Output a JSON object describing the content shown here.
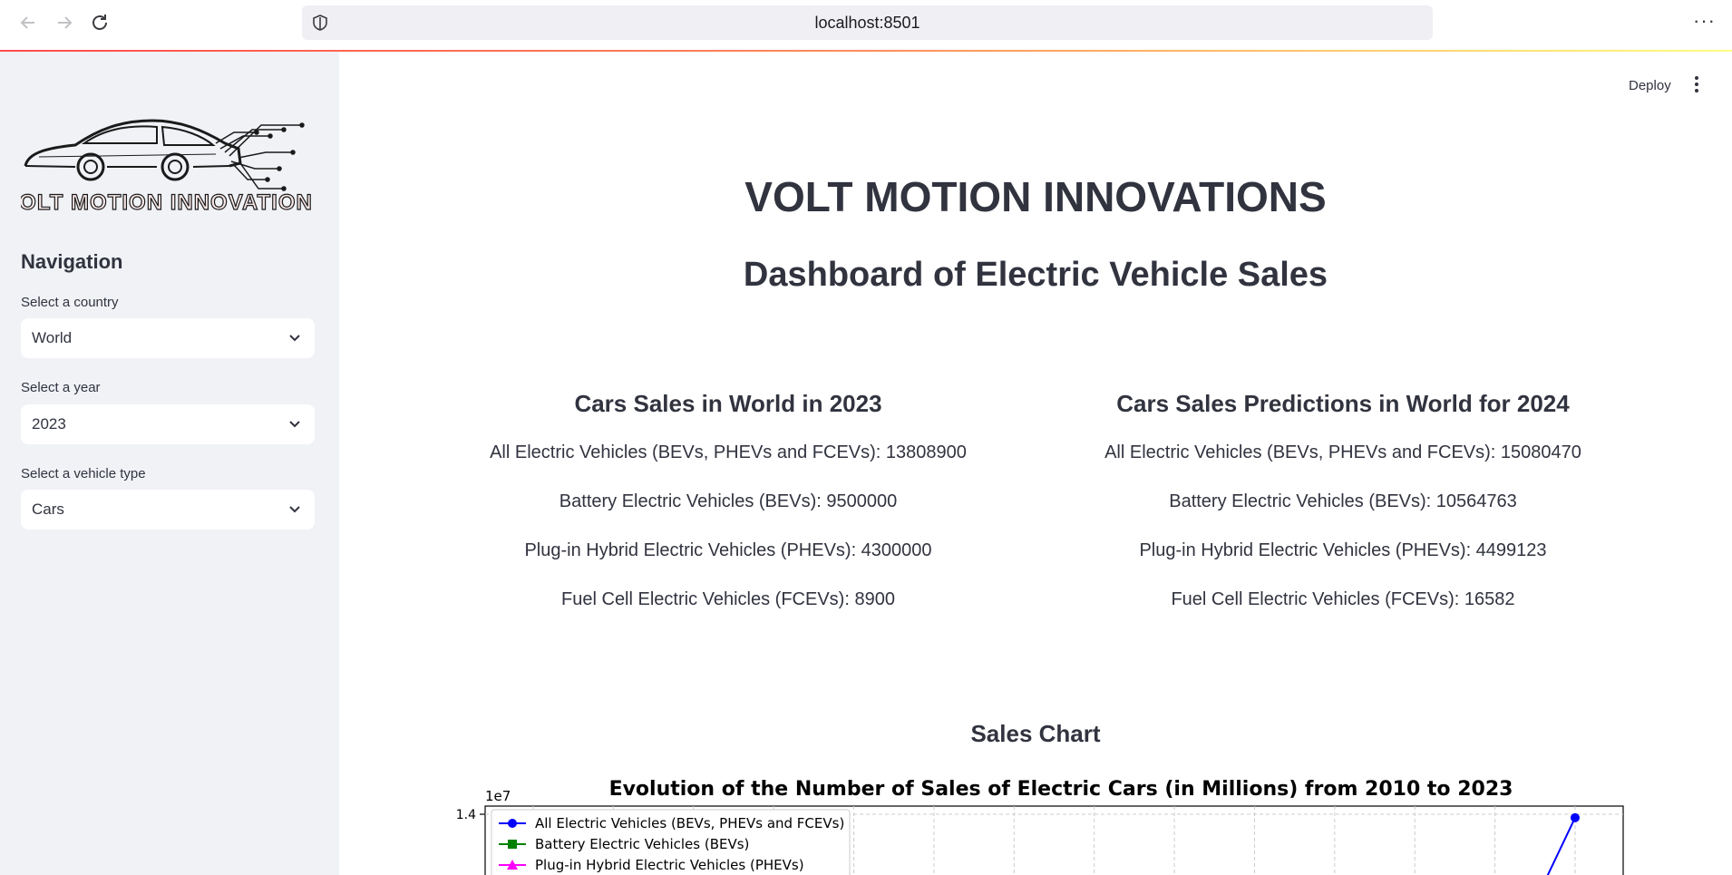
{
  "browser": {
    "url": "localhost:8501",
    "back_icon": "arrow-left-icon",
    "forward_icon": "arrow-right-icon",
    "reload_icon": "reload-icon",
    "menu_icon": "more-horizontal-icon",
    "menu_glyph": "···"
  },
  "sidebar": {
    "logo_text": "VOLT MOTION INNOVATIONS",
    "nav_title": "Navigation",
    "country_label": "Select a country",
    "country_value": "World",
    "year_label": "Select a year",
    "year_value": "2023",
    "vehicle_label": "Select a vehicle type",
    "vehicle_value": "Cars"
  },
  "toolbar": {
    "deploy_label": "Deploy"
  },
  "main": {
    "title": "VOLT MOTION INNOVATIONS",
    "subtitle": "Dashboard of Electric Vehicle Sales",
    "sales": {
      "heading": "Cars Sales in World in 2023",
      "all": "All Electric Vehicles (BEVs, PHEVs and FCEVs): 13808900",
      "bev": "Battery Electric Vehicles (BEVs): 9500000",
      "phev": "Plug-in Hybrid Electric Vehicles (PHEVs): 4300000",
      "fcev": "Fuel Cell Electric Vehicles (FCEVs): 8900"
    },
    "predictions": {
      "heading": "Cars Sales Predictions in World for 2024",
      "all": "All Electric Vehicles (BEVs, PHEVs and FCEVs): 15080470",
      "bev": "Battery Electric Vehicles (BEVs): 10564763",
      "phev": "Plug-in Hybrid Electric Vehicles (PHEVs): 4499123",
      "fcev": "Fuel Cell Electric Vehicles (FCEVs): 16582"
    },
    "chart_section_title": "Sales Chart"
  },
  "chart_data": {
    "type": "line",
    "title": "Evolution of the Number of Sales of Electric Cars (in Millions) from 2010 to 2023",
    "y_offset_label": "1e7",
    "y_ticks": [
      "1.4"
    ],
    "grid": true,
    "legend_position": "top-left",
    "legend": [
      {
        "name": "All Electric Vehicles (BEVs, PHEVs and FCEVs)",
        "color": "#0000ff",
        "marker": "circle"
      },
      {
        "name": "Battery Electric Vehicles (BEVs)",
        "color": "#008000",
        "marker": "square"
      },
      {
        "name": "Plug-in Hybrid Electric Vehicles (PHEVs)",
        "color": "#ff00ff",
        "marker": "triangle"
      }
    ],
    "series": [
      {
        "name": "All Electric Vehicles (BEVs, PHEVs and FCEVs)",
        "x": [
          2023
        ],
        "values": [
          13808900
        ]
      }
    ]
  }
}
